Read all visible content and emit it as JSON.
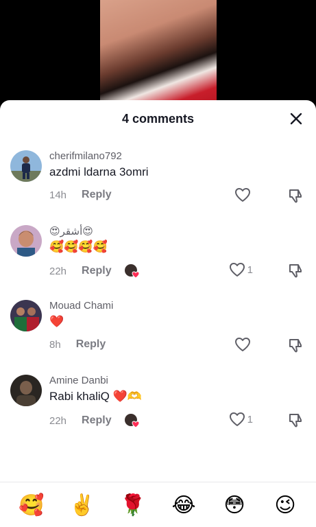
{
  "header": {
    "title": "4 comments"
  },
  "comments": [
    {
      "username": "cherifmilano792",
      "text": "azdmi ldarna 3omri",
      "time": "14h",
      "reply_label": "Reply",
      "likes": "",
      "creator_liked": false
    },
    {
      "username": "😍أشقر😍",
      "text": "🥰🥰🥰🥰",
      "time": "22h",
      "reply_label": "Reply",
      "likes": "1",
      "creator_liked": true
    },
    {
      "username": "Mouad Chami",
      "text": "❤️",
      "time": "8h",
      "reply_label": "Reply",
      "likes": "",
      "creator_liked": false
    },
    {
      "username": "Amine Danbi",
      "text": "Rabi khaliQ ❤️🫶",
      "time": "22h",
      "reply_label": "Reply",
      "likes": "1",
      "creator_liked": true
    }
  ],
  "emoji_bar": [
    "🥰",
    "✌️",
    "🌹",
    "😂",
    "😳",
    "😉"
  ],
  "colors": {
    "heart_badge": "#fe2c55",
    "text": "#161823",
    "muted": "#8a8b91"
  }
}
